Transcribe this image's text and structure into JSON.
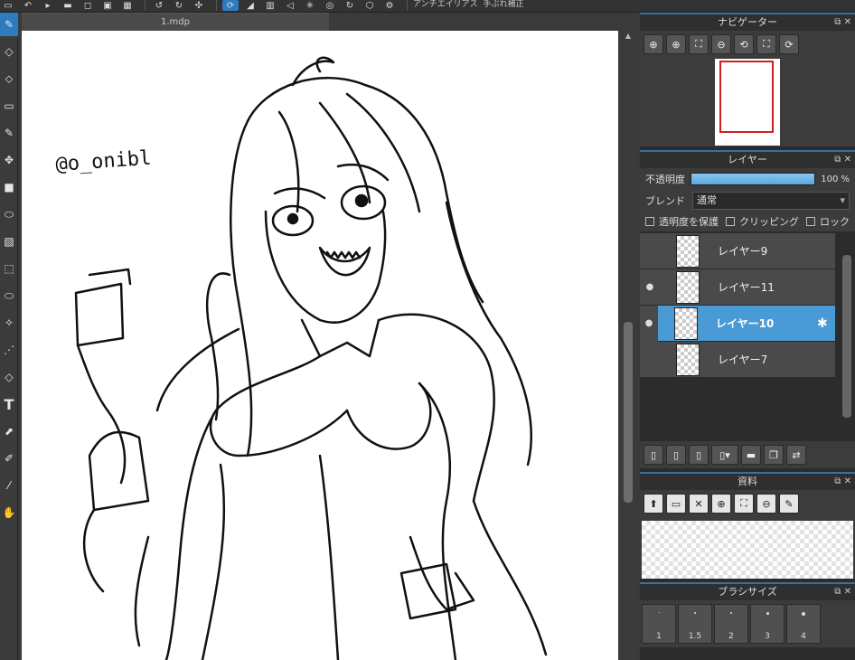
{
  "toolbar": {
    "items": [
      "▭",
      "↶",
      "▸",
      "▬",
      "◻",
      "▣",
      "▦"
    ],
    "nav": [
      "↺",
      "↻",
      "✣"
    ],
    "modes": [
      "⟳",
      "◢",
      "▥",
      "◁",
      "✳",
      "◎",
      "↻",
      "⬡",
      "⚙"
    ],
    "checkbox_label": "アンチエイリアス",
    "hand_label": "手ぶれ補正"
  },
  "tools": [
    "✎",
    "◇",
    "⬦",
    "▭",
    "✎",
    "✥",
    "■",
    "⬭",
    "▧",
    "⬚",
    "⬭",
    "✧",
    "⋰",
    "◇",
    "T",
    "⬈",
    "✐",
    "⁄",
    "✋"
  ],
  "document": {
    "tab_title": "1.mdp"
  },
  "canvas": {
    "watermark": "@o_onibl"
  },
  "navigator": {
    "title": "ナビゲーター",
    "buttons": [
      "⊕",
      "⊕",
      "⛶",
      "⊖",
      "⟲",
      "⛶",
      "⟳"
    ]
  },
  "layers": {
    "title": "レイヤー",
    "opacity_label": "不透明度",
    "opacity_value": "100 %",
    "opacity": 1.0,
    "blend_label": "ブレンド",
    "blend_value": "通常",
    "protect_label": "透明度を保護",
    "clip_label": "クリッピング",
    "lock_label": "ロック",
    "items": [
      {
        "name": "レイヤー9",
        "visible": false,
        "selected": false
      },
      {
        "name": "レイヤー11",
        "visible": true,
        "selected": false
      },
      {
        "name": "レイヤー10",
        "visible": true,
        "selected": true
      },
      {
        "name": "レイヤー7",
        "visible": false,
        "selected": false
      }
    ],
    "buttons": [
      "▯",
      "▯",
      "▯",
      "▯▾",
      "▬",
      "❐",
      "⇄"
    ]
  },
  "materials": {
    "title": "資料",
    "buttons": [
      "⬆",
      "▭",
      "✕",
      "⊕",
      "⛶",
      "⊖",
      "✎"
    ]
  },
  "brush_size": {
    "title": "ブラシサイズ",
    "sizes": [
      "1",
      "1.5",
      "2",
      "3",
      "4"
    ]
  },
  "panel_controls": {
    "float": "⧉",
    "close": "✕"
  }
}
